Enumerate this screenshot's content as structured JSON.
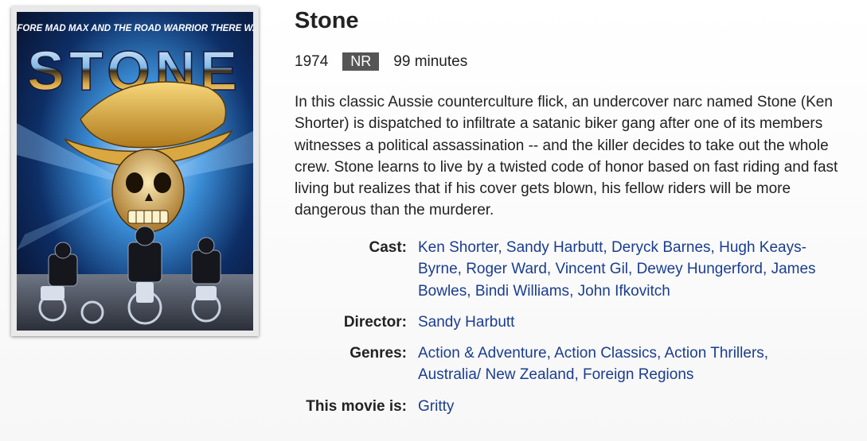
{
  "movie": {
    "title": "Stone",
    "year": "1974",
    "rating": "NR",
    "duration": "99 minutes",
    "synopsis": "In this classic Aussie counterculture flick, an undercover narc named Stone (Ken Shorter) is dispatched to infiltrate a satanic biker gang after one of its members witnesses a political assassination -- and the killer decides to take out the whole crew. Stone learns to live by a twisted code of honor based on fast riding and fast living but realizes that if his cover gets blown, his fellow riders will be more dangerous than the murderer."
  },
  "poster": {
    "tagline": "BEFORE MAD MAX AND THE ROAD WARRIOR THERE WAS",
    "logo_text": "STONE"
  },
  "details": {
    "cast_label": "Cast:",
    "cast": [
      "Ken Shorter",
      "Sandy Harbutt",
      "Deryck Barnes",
      "Hugh Keays-Byrne",
      "Roger Ward",
      "Vincent Gil",
      "Dewey Hungerford",
      "James Bowles",
      "Bindi Williams",
      "John Ifkovitch"
    ],
    "director_label": "Director:",
    "director": [
      "Sandy Harbutt"
    ],
    "genres_label": "Genres:",
    "genres": [
      "Action & Adventure",
      "Action Classics",
      "Action Thrillers",
      "Australia/ New Zealand",
      "Foreign Regions"
    ],
    "moods_label": "This movie is:",
    "moods": [
      "Gritty"
    ]
  },
  "colors": {
    "link": "#1a3d8f",
    "rating_badge": "#555555",
    "text": "#222222"
  }
}
